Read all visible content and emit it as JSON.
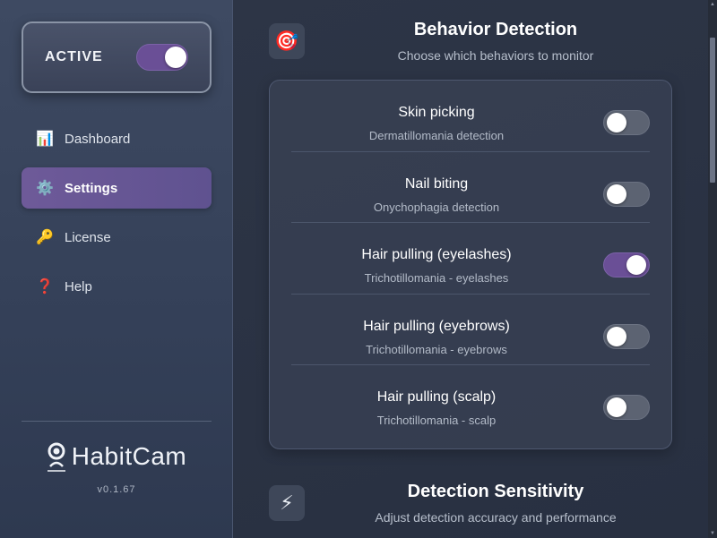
{
  "sidebar": {
    "active_card": {
      "label": "ACTIVE",
      "on": true
    },
    "nav": [
      {
        "label": "Dashboard",
        "icon": "📊",
        "icon_name": "chart-icon",
        "selected": false
      },
      {
        "label": "Settings",
        "icon": "⚙️",
        "icon_name": "gear-icon",
        "selected": true
      },
      {
        "label": "License",
        "icon": "🔑",
        "icon_name": "key-icon",
        "selected": false
      },
      {
        "label": "Help",
        "icon": "❓",
        "icon_name": "question-icon",
        "selected": false
      }
    ],
    "logo_text": "HabitCam",
    "version": "v0.1.67"
  },
  "behavior_section": {
    "icon": "🎯",
    "title": "Behavior Detection",
    "subtitle": "Choose which behaviors to monitor",
    "behaviors": [
      {
        "title": "Skin picking",
        "subtitle": "Dermatillomania detection",
        "on": false
      },
      {
        "title": "Nail biting",
        "subtitle": "Onychophagia detection",
        "on": false
      },
      {
        "title": "Hair pulling (eyelashes)",
        "subtitle": "Trichotillomania - eyelashes",
        "on": true
      },
      {
        "title": "Hair pulling (eyebrows)",
        "subtitle": "Trichotillomania - eyebrows",
        "on": false
      },
      {
        "title": "Hair pulling (scalp)",
        "subtitle": "Trichotillomania - scalp",
        "on": false
      }
    ]
  },
  "sensitivity_section": {
    "icon": "⚡",
    "title": "Detection Sensitivity",
    "subtitle": "Adjust detection accuracy and performance"
  },
  "colors": {
    "accent": "#6a4f96",
    "toggle_off": "#5c6372",
    "sidebar_bg": "#3a465d",
    "main_bg": "#2a3242"
  }
}
